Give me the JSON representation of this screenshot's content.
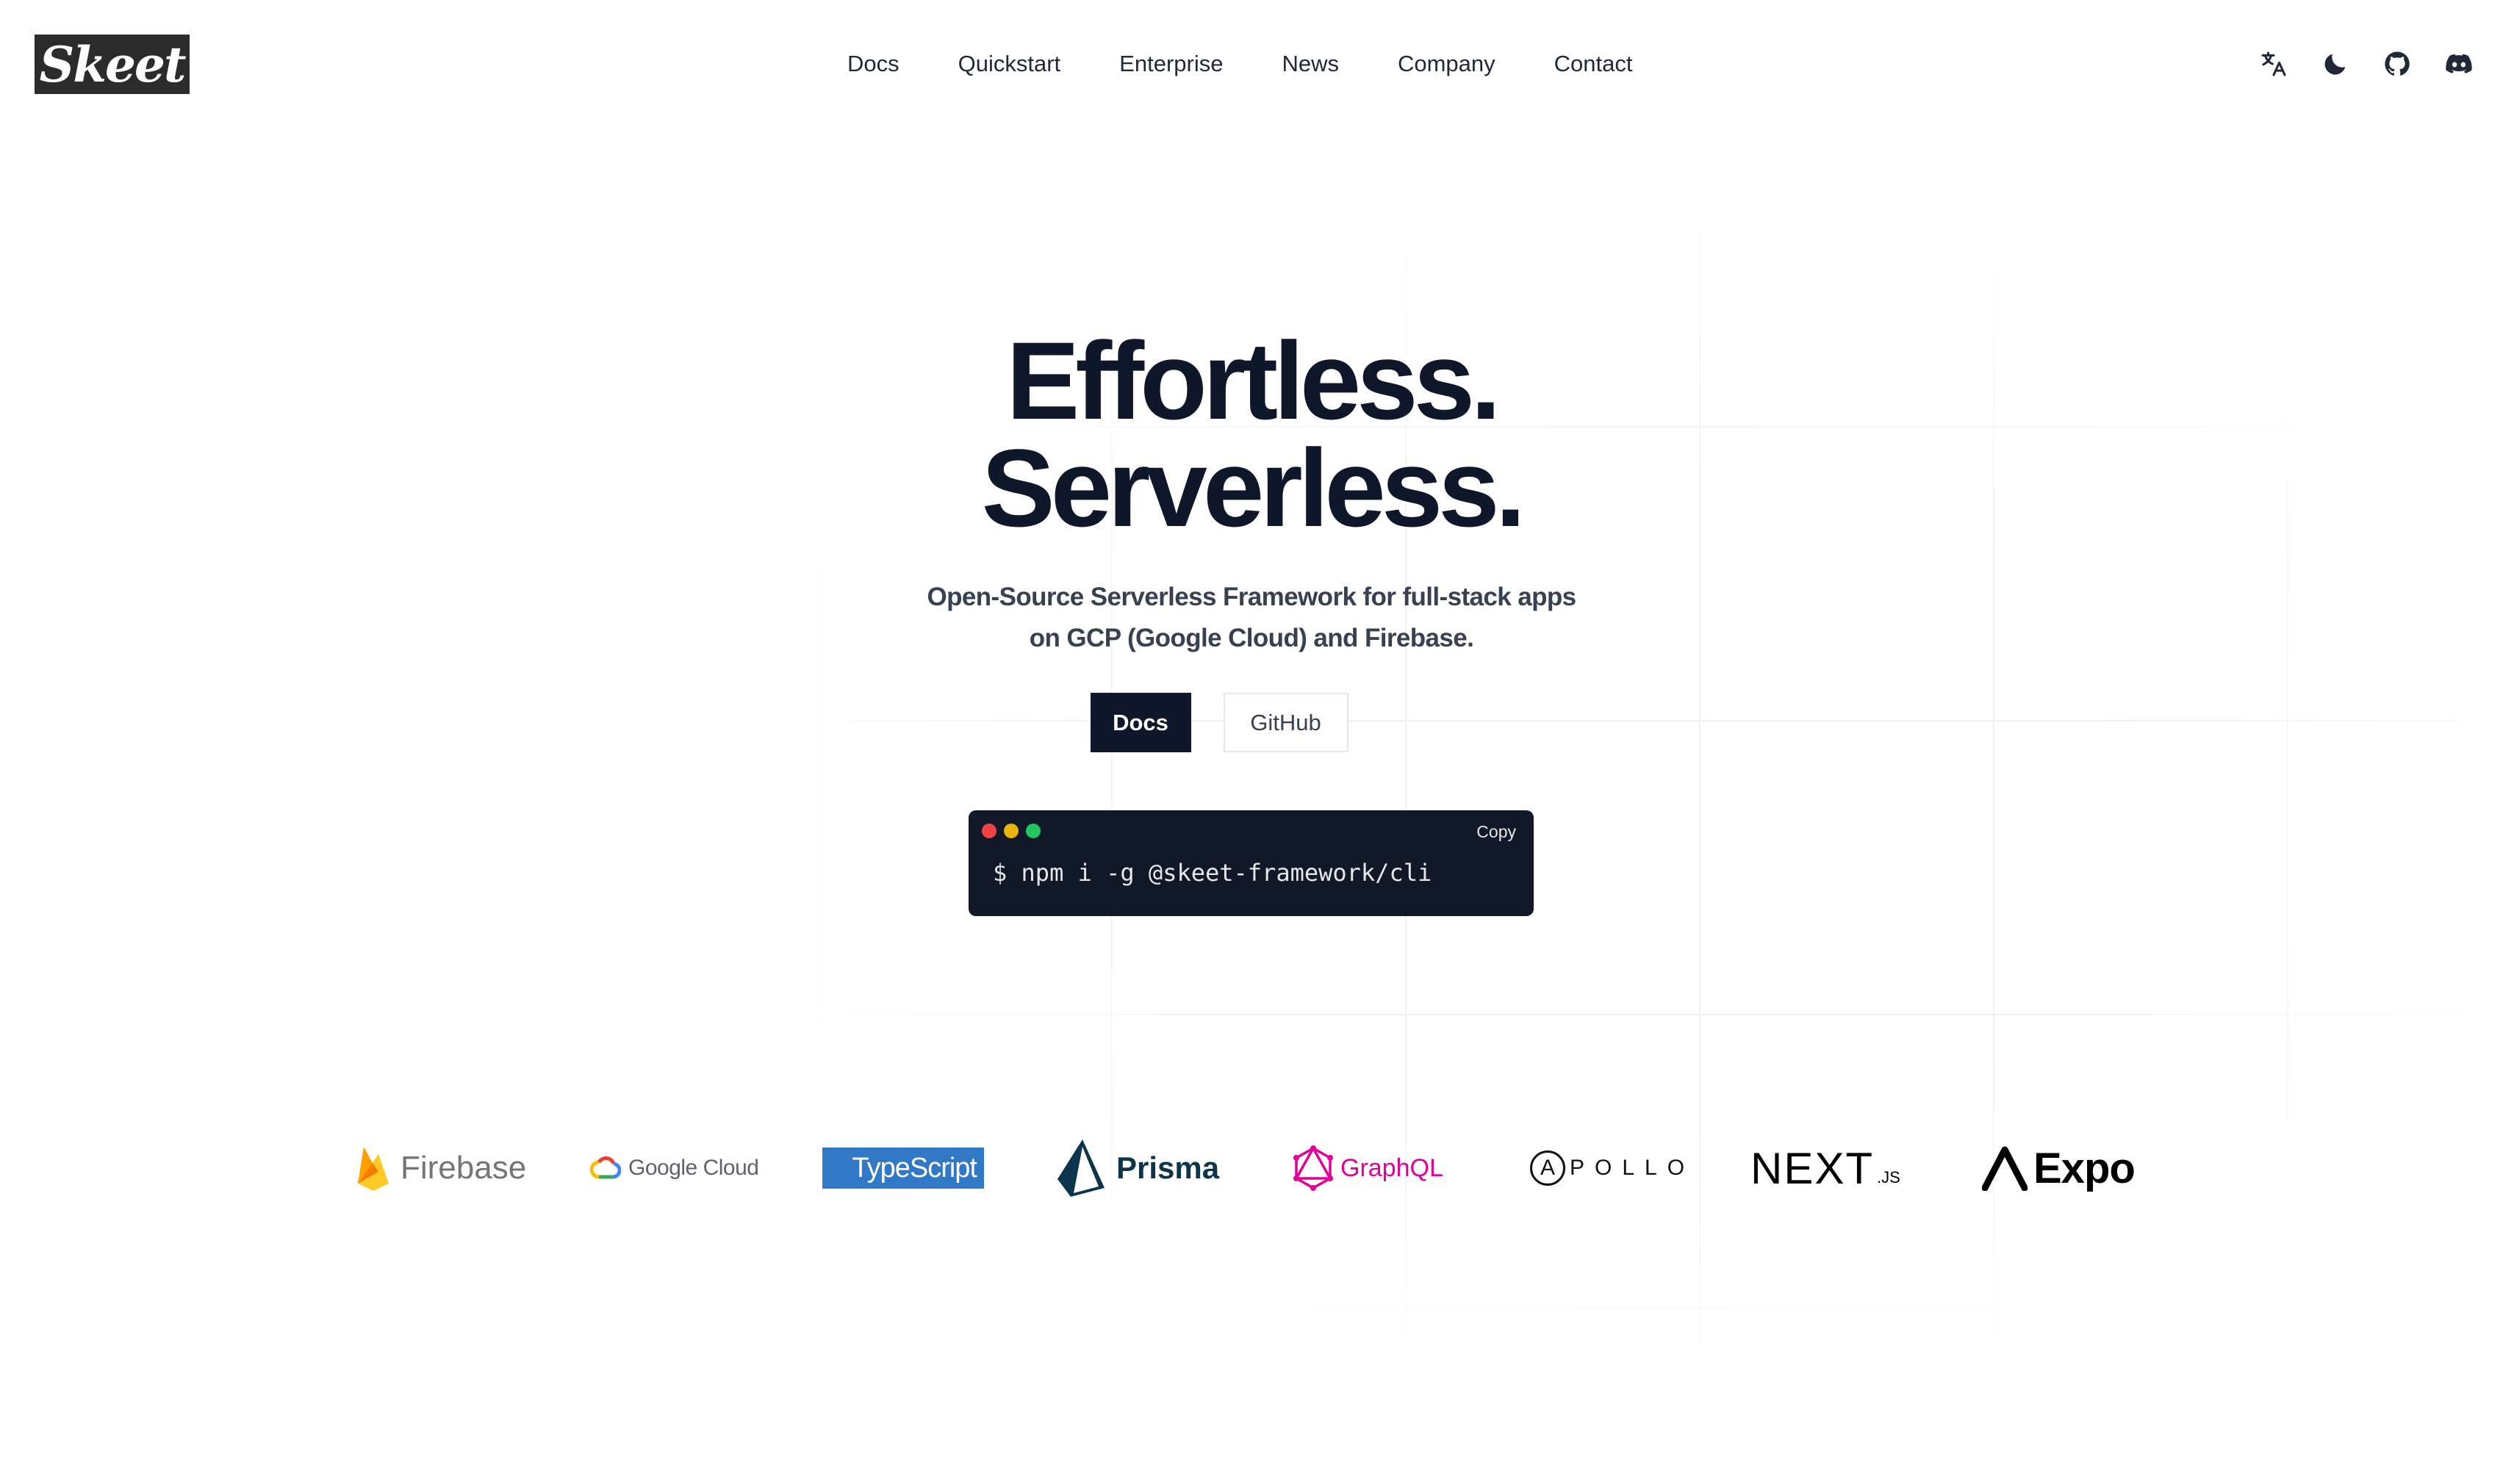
{
  "brand": {
    "logo_text": "Skeet"
  },
  "nav": {
    "items": [
      {
        "label": "Docs"
      },
      {
        "label": "Quickstart"
      },
      {
        "label": "Enterprise"
      },
      {
        "label": "News"
      },
      {
        "label": "Company"
      },
      {
        "label": "Contact"
      }
    ]
  },
  "header_icons": [
    "translate-icon",
    "moon-icon",
    "github-icon",
    "discord-icon"
  ],
  "hero": {
    "title_line1": "Effortless.",
    "title_line2": "Serverless.",
    "subtitle_line1": "Open-Source Serverless Framework for full-stack apps",
    "subtitle_line2": "on GCP (Google Cloud) and Firebase.",
    "primary_button": "Docs",
    "secondary_button": "GitHub"
  },
  "terminal": {
    "copy_label": "Copy",
    "command": "$ npm i -g @skeet-framework/cli",
    "dot_colors": [
      "#ef4444",
      "#eab308",
      "#22c55e"
    ]
  },
  "tech_logos": {
    "firebase": "Firebase",
    "google_cloud": "Google Cloud",
    "typescript": "TypeScript",
    "prisma": "Prisma",
    "graphql": "GraphQL",
    "apollo_initial": "A",
    "apollo_rest": "POLLO",
    "nextjs": "NEXT",
    "nextjs_suffix": ".JS",
    "expo": "Expo"
  },
  "colors": {
    "dark": "#0f172a",
    "typescript_blue": "#3178c6",
    "graphql_pink": "#e10098",
    "prisma_navy": "#0c344b"
  }
}
